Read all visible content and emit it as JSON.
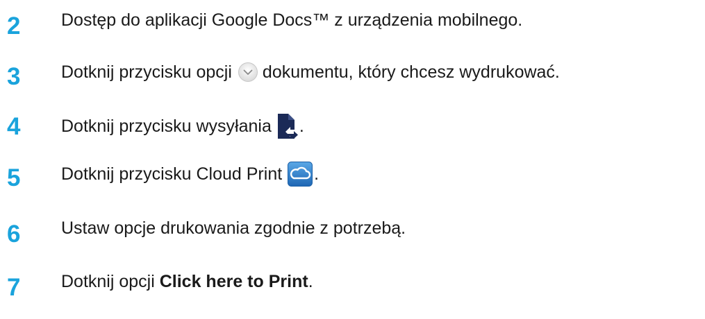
{
  "steps": [
    {
      "number": "2",
      "text": "Dostęp do aplikacji Google Docs™ z urządzenia mobilnego."
    },
    {
      "number": "3",
      "text_before": "Dotknij przycisku opcji",
      "text_after": "dokumentu, który chcesz wydrukować.",
      "icon": "options-circle-icon"
    },
    {
      "number": "4",
      "text_before": "Dotknij przycisku wysyłania",
      "text_after": ".",
      "icon": "send-document-icon"
    },
    {
      "number": "5",
      "text_before": "Dotknij przycisku Cloud Print",
      "text_after": ".",
      "icon": "cloud-print-icon"
    },
    {
      "number": "6",
      "text": "Ustaw opcje drukowania zgodnie z potrzebą."
    },
    {
      "number": "7",
      "text_before": "Dotknij opcji",
      "bold": "Click here to Print",
      "text_after": "."
    }
  ],
  "colors": {
    "step_number": "#1aa3dc",
    "text": "#1a1a1a",
    "send_icon": "#1b2a57",
    "cloud_icon": "#2b79c2"
  }
}
